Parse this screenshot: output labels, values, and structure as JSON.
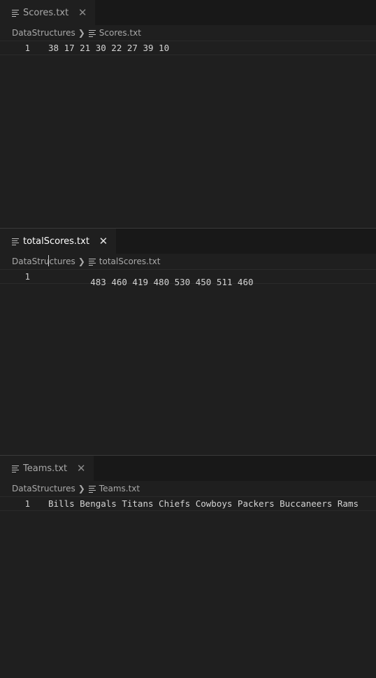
{
  "panes": [
    {
      "tab": {
        "label": "Scores.txt",
        "active": false
      },
      "breadcrumb": {
        "folder": "DataStructures",
        "file": "Scores.txt"
      },
      "lines": [
        {
          "number": "1",
          "text": "38 17 21 30 22 27 39 10"
        }
      ]
    },
    {
      "tab": {
        "label": "totalScores.txt",
        "active": true
      },
      "breadcrumb": {
        "folder": "DataStructures",
        "file": "totalScores.txt"
      },
      "lines": [
        {
          "number": "1",
          "text": "483 460 419 480 530 450 511 460"
        }
      ]
    },
    {
      "tab": {
        "label": "Teams.txt",
        "active": false
      },
      "breadcrumb": {
        "folder": "DataStructures",
        "file": "Teams.txt"
      },
      "lines": [
        {
          "number": "1",
          "text": "Bills Bengals Titans Chiefs Cowboys Packers Buccaneers Rams"
        }
      ]
    }
  ],
  "icons": {
    "file": "file-lines-icon",
    "close": "close-icon",
    "chevron": "chevron-right-icon"
  },
  "glyphs": {
    "close": "✕",
    "chevron": "❯"
  },
  "colors": {
    "background": "#1f1f1f",
    "tabbar": "#181818",
    "text": "#cccccc"
  }
}
